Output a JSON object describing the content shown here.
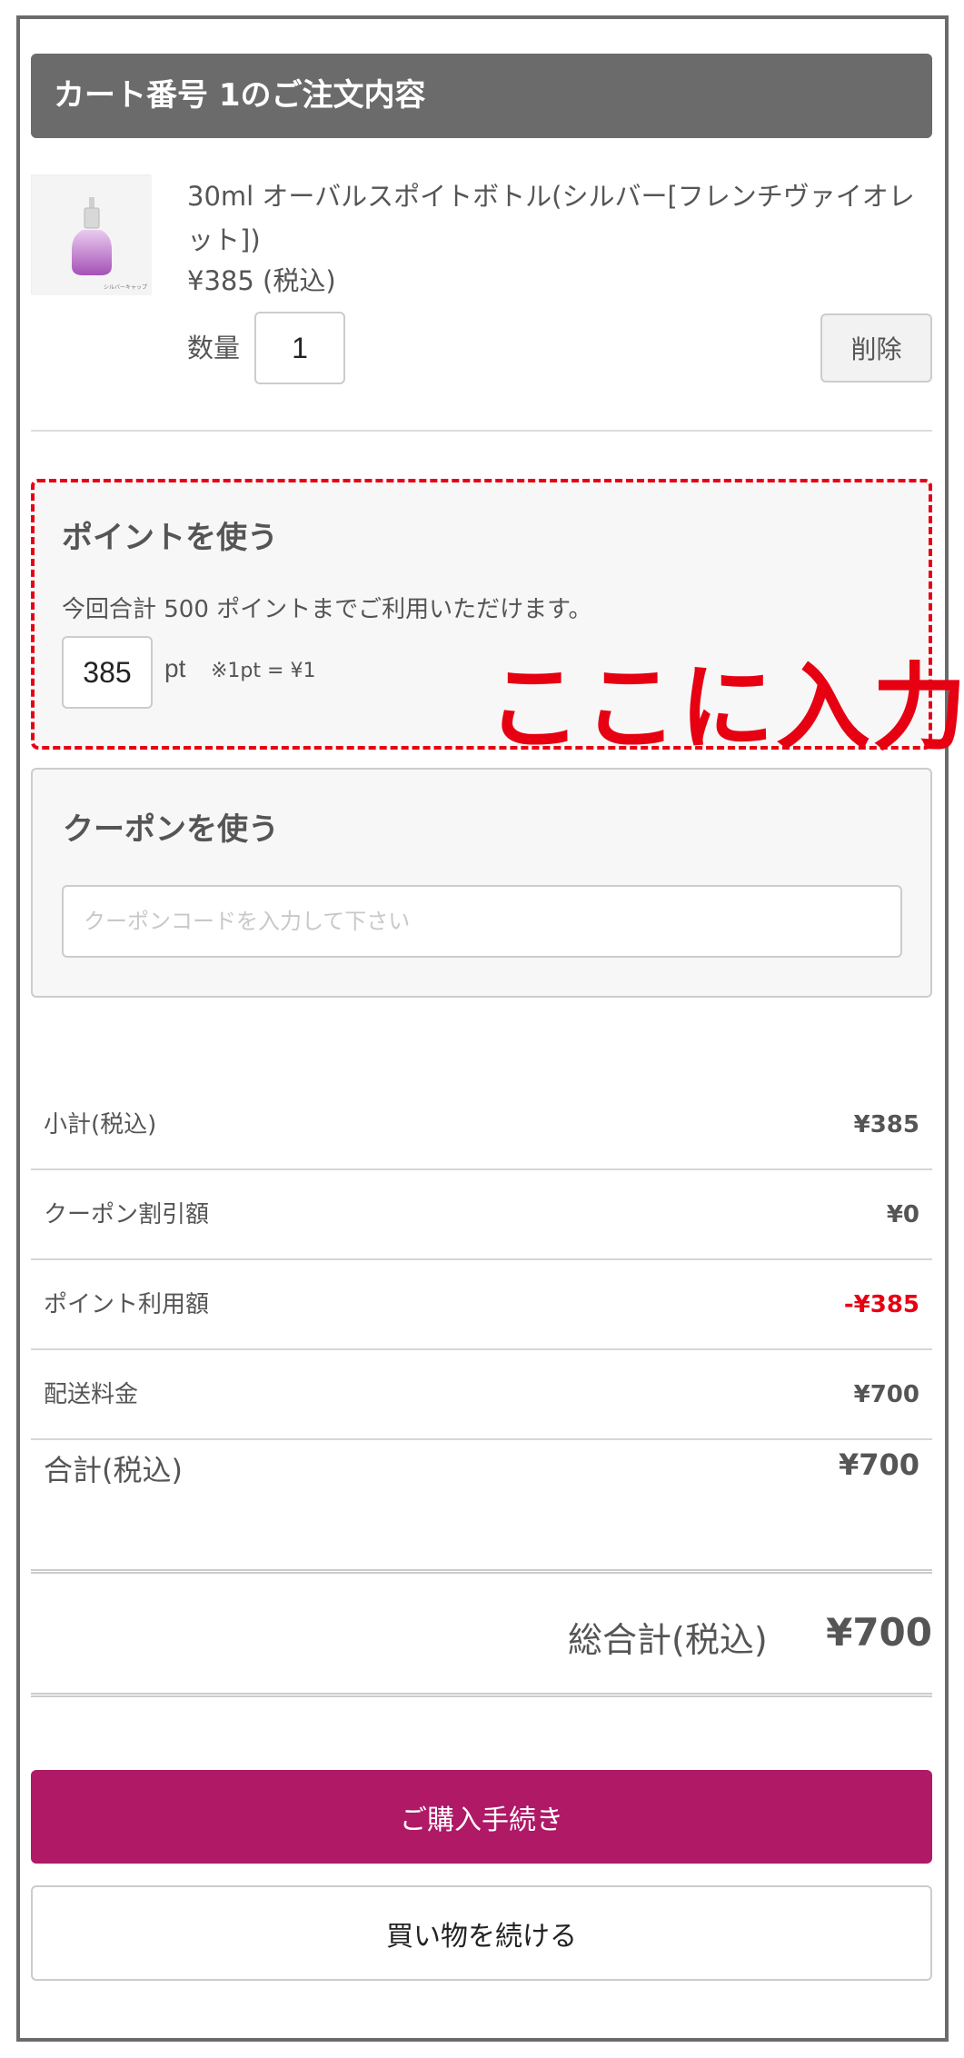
{
  "cart": {
    "header_title": "カート番号 1のご注文内容",
    "item": {
      "name": "30ml オーバルスポイトボトル(シルバー[フレンチヴァイオレット])",
      "price": "¥385 (税込)",
      "quantity_label": "数量",
      "quantity_value": "1",
      "delete_label": "削除",
      "thumb_caption": "シルバーキャップ"
    }
  },
  "points": {
    "title": "ポイントを使う",
    "description": "今回合計 500 ポイントまでご利用いただけます。",
    "input_value": "385",
    "unit": "pt",
    "note": "※1pt = ¥1",
    "annotation": "ここに入力"
  },
  "coupon": {
    "title": "クーポンを使う",
    "placeholder": "クーポンコードを入力して下さい"
  },
  "summary": {
    "rows": [
      {
        "label": "小計(税込)",
        "value": "¥385"
      },
      {
        "label": "クーポン割引額",
        "value": "¥0"
      },
      {
        "label": "ポイント利用額",
        "value": "-¥385"
      },
      {
        "label": "配送料金",
        "value": "¥700"
      }
    ],
    "total_label": "合計(税込)",
    "total_value": "¥700"
  },
  "grand_total": {
    "label": "総合計(税込)",
    "value": "¥700"
  },
  "actions": {
    "checkout_label": "ご購入手続き",
    "continue_label": "買い物を続ける"
  },
  "colors": {
    "header_bg": "#6b6b6b",
    "accent_red": "#e60012",
    "checkout_bg": "#af1966",
    "panel_bg": "#f7f7f7"
  }
}
